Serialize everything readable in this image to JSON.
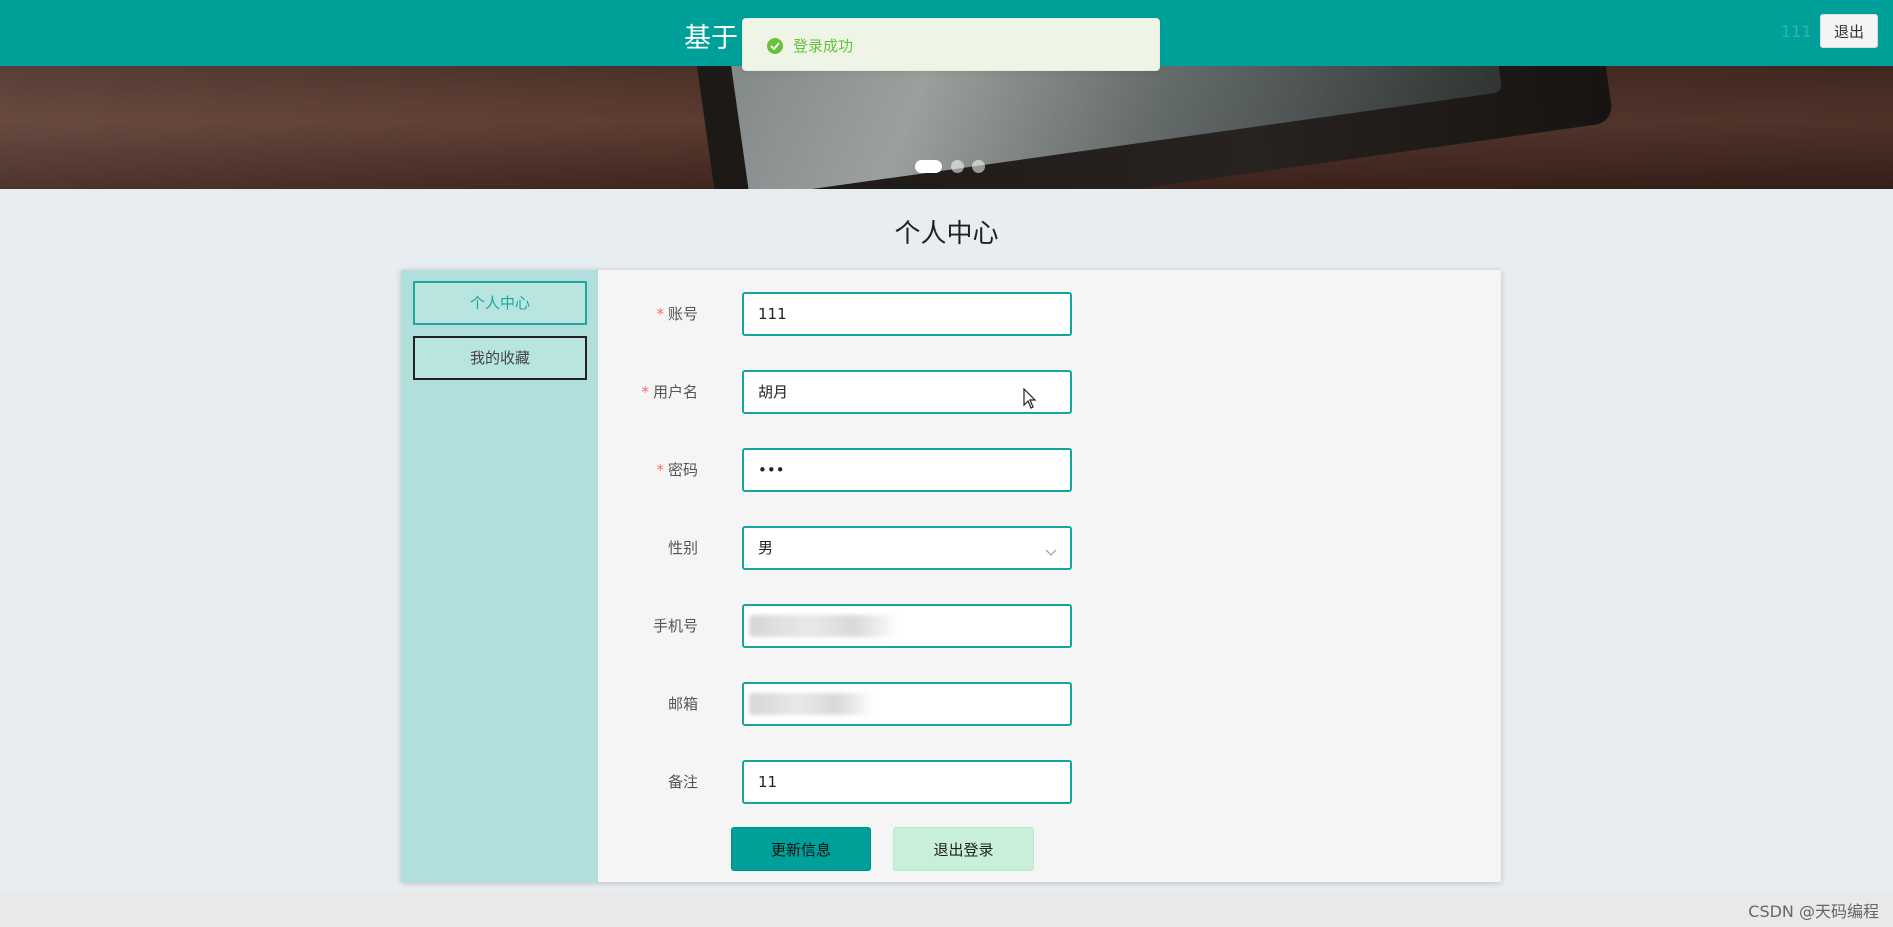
{
  "header": {
    "site_title": "基于",
    "username": "111",
    "logout_label": "退出"
  },
  "toast": {
    "message": "登录成功"
  },
  "carousel": {
    "slide_count": 3,
    "active_index": 0
  },
  "page": {
    "title": "个人中心"
  },
  "sidebar": {
    "items": [
      {
        "label": "个人中心",
        "active": true
      },
      {
        "label": "我的收藏",
        "active": false
      }
    ]
  },
  "form": {
    "fields": [
      {
        "label": "账号",
        "required": true,
        "value": "111"
      },
      {
        "label": "用户名",
        "required": true,
        "value": "胡月"
      },
      {
        "label": "密码",
        "required": true,
        "value": "•••"
      },
      {
        "label": "性别",
        "required": false,
        "value": "男"
      },
      {
        "label": "手机号",
        "required": false,
        "value": ""
      },
      {
        "label": "邮箱",
        "required": false,
        "value": ""
      },
      {
        "label": "备注",
        "required": false,
        "value": "11"
      }
    ],
    "required_mark": "*",
    "update_label": "更新信息",
    "logout_label": "退出登录"
  },
  "watermark": "CSDN @天码编程",
  "colors": {
    "primary": "#00a09a",
    "sidebar_bg": "#b1e0dc",
    "success": "#67c23a",
    "required": "#f56c6c"
  }
}
